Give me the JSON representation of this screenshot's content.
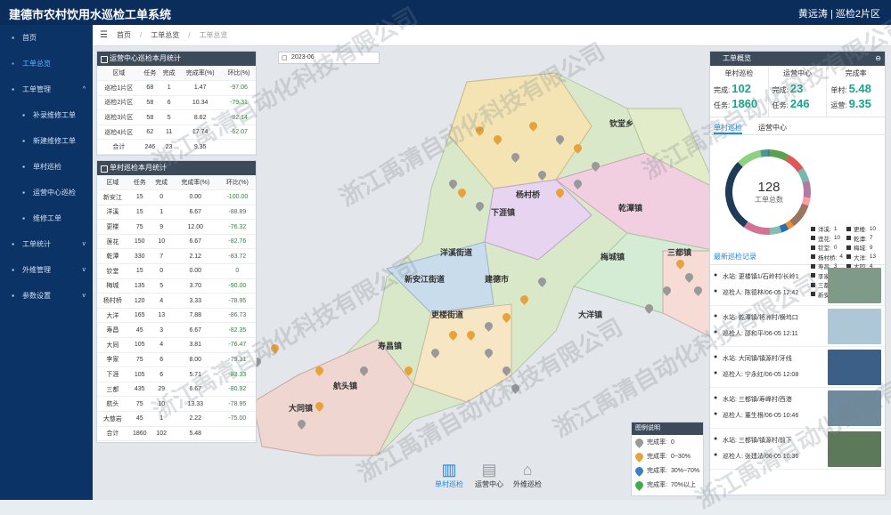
{
  "app": {
    "title": "建德市农村饮用水巡检工单系统",
    "user": "黄远涛 | 巡检2片区"
  },
  "sidebar": [
    {
      "label": "首页",
      "icon": "dashboard-icon"
    },
    {
      "label": "工单总览",
      "icon": "globe-icon",
      "active": true
    },
    {
      "label": "工单管理",
      "icon": "folder-icon",
      "arrow": "^"
    },
    {
      "label": "补录维修工单",
      "icon": "edit-icon",
      "sub": true
    },
    {
      "label": "新建维修工单",
      "icon": "document-icon",
      "sub": true
    },
    {
      "label": "单村巡检",
      "icon": "list-icon",
      "sub": true
    },
    {
      "label": "运营中心巡检",
      "icon": "bar-chart-icon",
      "sub": true
    },
    {
      "label": "维修工单",
      "icon": "document-icon",
      "sub": true
    },
    {
      "label": "工单统计",
      "icon": "chart-icon",
      "arrow": "v"
    },
    {
      "label": "外维管理",
      "icon": "folder-icon",
      "arrow": "v"
    },
    {
      "label": "参数设置",
      "icon": "settings-icon",
      "arrow": "v"
    }
  ],
  "breadcrumb": {
    "home": "首页",
    "l1": "工单总览",
    "l2": "工单总览",
    "sep": "/"
  },
  "date": "2023-06",
  "center_table": {
    "title": "运营中心巡检本月统计",
    "headers": [
      "区域",
      "任务",
      "完成",
      "完成率(%)",
      "环比(%)"
    ],
    "rows": [
      [
        "巡检1片区",
        "68",
        "1",
        "1.47",
        "-97.06"
      ],
      [
        "巡检2片区",
        "58",
        "6",
        "10.34",
        "-79.31"
      ],
      [
        "巡检3片区",
        "58",
        "5",
        "8.62",
        "-82.14"
      ],
      [
        "巡检4片区",
        "62",
        "11",
        "17.74",
        "-62.07"
      ],
      [
        "合计",
        "246",
        "23",
        "9.35",
        ""
      ]
    ]
  },
  "village_table": {
    "title": "单村巡检本月统计",
    "headers": [
      "区域",
      "任务",
      "完成",
      "完成率(%)",
      "环比(%)"
    ],
    "rows": [
      [
        "新安江",
        "15",
        "0",
        "0.00",
        "-100.00"
      ],
      [
        "洋溪",
        "15",
        "1",
        "6.67",
        "-88.89"
      ],
      [
        "更楼",
        "75",
        "9",
        "12.00",
        "-76.32"
      ],
      [
        "莲花",
        "150",
        "10",
        "6.67",
        "-82.76"
      ],
      [
        "乾潭",
        "330",
        "7",
        "2.12",
        "-83.72"
      ],
      [
        "钦堂",
        "15",
        "0",
        "0.00",
        "0"
      ],
      [
        "梅城",
        "135",
        "5",
        "3.70",
        "-90.00"
      ],
      [
        "杨村桥",
        "120",
        "4",
        "3.33",
        "-78.95"
      ],
      [
        "大洋",
        "165",
        "13",
        "7.88",
        "-86.73"
      ],
      [
        "寿昌",
        "45",
        "3",
        "6.67",
        "-82.35"
      ],
      [
        "大同",
        "105",
        "4",
        "3.81",
        "-76.47"
      ],
      [
        "李家",
        "75",
        "6",
        "8.00",
        "-79.31"
      ],
      [
        "下涯",
        "105",
        "6",
        "5.71",
        "-83.33"
      ],
      [
        "三都",
        "435",
        "29",
        "6.67",
        "-80.92"
      ],
      [
        "航头",
        "75",
        "10",
        "13.33",
        "-78.95"
      ],
      [
        "大慈岩",
        "45",
        "1",
        "2.22",
        "-75.00"
      ],
      [
        "合计",
        "1860",
        "102",
        "5.48",
        ""
      ]
    ]
  },
  "overview": {
    "title": "工单概览",
    "cols": [
      {
        "title": "单村巡检",
        "r1l": "完成:",
        "r1v": "102",
        "r2l": "任务:",
        "r2v": "1860"
      },
      {
        "title": "运营中心",
        "r1l": "完成:",
        "r1v": "23",
        "r2l": "任务:",
        "r2v": "246"
      },
      {
        "title": "完成率",
        "r1l": "单村:",
        "r1v": "5.48",
        "r2l": "运营:",
        "r2v": "9.35"
      }
    ]
  },
  "tabs": [
    "单村巡检",
    "运营中心"
  ],
  "donut": {
    "total": "128",
    "label": "工单总数"
  },
  "donut_legend": [
    [
      "洋溪:",
      "1"
    ],
    [
      "更楼:",
      "10"
    ],
    [
      "莲花:",
      "10"
    ],
    [
      "乾潭:",
      "7"
    ],
    [
      "钦堂:",
      "0"
    ],
    [
      "梅城:",
      "9"
    ],
    [
      "杨村桥:",
      "4"
    ],
    [
      "大洋:",
      "13"
    ],
    [
      "寿昌:",
      "3"
    ],
    [
      "大同:",
      "4"
    ],
    [
      "李家:",
      "6"
    ],
    [
      "下涯:",
      "14"
    ],
    [
      "三都:",
      "38"
    ],
    [
      "航头:",
      "13"
    ],
    [
      "新安江:",
      "0"
    ],
    [
      "航头:",
      "4"
    ]
  ],
  "records_title": "最新巡检记录",
  "records": [
    {
      "site": "更楼镇1/石岭村/长岭1",
      "user": "陈德林/06-05 12:42"
    },
    {
      "site": "乾潭镇/将洲村/横坞口",
      "user": "邵和平/06-05 12:11"
    },
    {
      "site": "大同镇/镇源村/牙线",
      "user": "宁永红/06-05 12:08"
    },
    {
      "site": "三都镇/寿峰村/西港",
      "user": "董生根/06-05 10:46"
    },
    {
      "site": "三都镇/镇源村/前下",
      "user": "张建法/06-05 10:36"
    }
  ],
  "record_labels": {
    "site": "水站:",
    "user": "巡检人:"
  },
  "bottom_nav": [
    "单村巡检",
    "运营中心",
    "外维巡检"
  ],
  "map_legend": {
    "title": "图例说明",
    "items": [
      [
        "完成率:",
        "0"
      ],
      [
        "完成率:",
        "0~30%"
      ],
      [
        "完成率:",
        "30%~70%"
      ],
      [
        "完成率:",
        "70%以上"
      ]
    ]
  },
  "towns": [
    "钦堂乡",
    "杨村桥",
    "乾潭镇",
    "下涯镇",
    "洋溪街道",
    "新安江街道",
    "建德市",
    "梅城镇",
    "更楼街道",
    "三都镇",
    "大洋镇",
    "寿昌镇",
    "航头镇",
    "大同镇"
  ],
  "watermark": "浙江禹清自动化科技有限公司"
}
